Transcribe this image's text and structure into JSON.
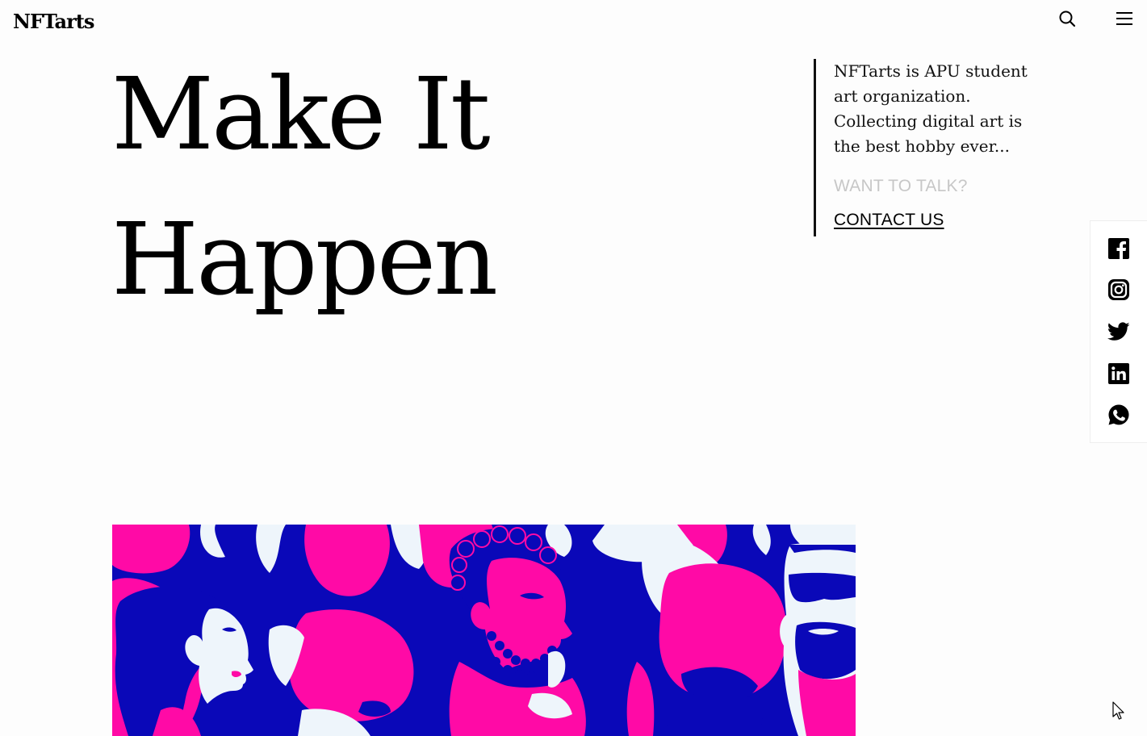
{
  "header": {
    "logo": "NFTarts",
    "search_icon": "search-icon",
    "menu_icon": "hamburger-menu-icon"
  },
  "hero": {
    "title_line1": "Make It",
    "title_line2": "Happen"
  },
  "intro": {
    "text": "NFTarts is APU student art organization. Collecting digital art is the best hobby ever...",
    "talk_label": "WANT TO TALK?",
    "contact_label": "CONTACT US"
  },
  "social": [
    {
      "name": "facebook",
      "icon": "facebook-icon"
    },
    {
      "name": "instagram",
      "icon": "instagram-icon"
    },
    {
      "name": "twitter",
      "icon": "twitter-icon"
    },
    {
      "name": "linkedin",
      "icon": "linkedin-icon"
    },
    {
      "name": "whatsapp",
      "icon": "whatsapp-icon"
    }
  ],
  "banner": {
    "image": "illustration-crowd-people"
  },
  "colors": {
    "background": "#fdfdfd",
    "text": "#000000",
    "muted": "#c7c7c7",
    "banner_blue": "#0a08b8",
    "banner_pink": "#ff0aa6",
    "banner_light": "#eef5fb"
  }
}
